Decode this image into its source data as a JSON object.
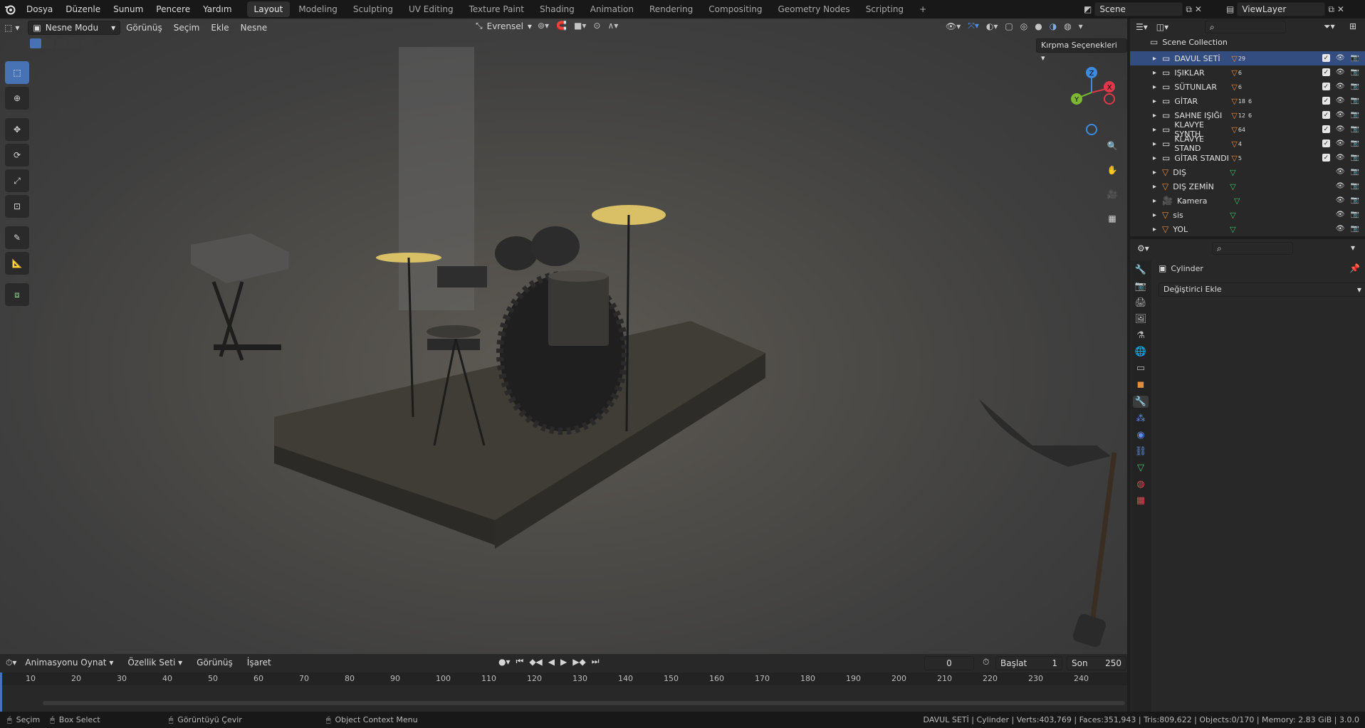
{
  "menubar": {
    "menus": [
      "Dosya",
      "Düzenle",
      "Sunum",
      "Pencere",
      "Yardım"
    ],
    "workspaces": [
      "Layout",
      "Modeling",
      "Sculpting",
      "UV Editing",
      "Texture Paint",
      "Shading",
      "Animation",
      "Rendering",
      "Compositing",
      "Geometry Nodes",
      "Scripting"
    ],
    "active_workspace": "Layout",
    "scene": "Scene",
    "view_layer": "ViewLayer"
  },
  "viewport_header": {
    "mode": "Nesne Modu",
    "menus": [
      "Görünüş",
      "Seçim",
      "Ekle",
      "Nesne"
    ],
    "orientation": "Evrensel",
    "clipping": "Kırpma Seçenekleri"
  },
  "gizmo": {
    "z": "Z",
    "y": "Y",
    "x": "X"
  },
  "outliner": {
    "root": "Scene Collection",
    "rows": [
      {
        "label": "DAVUL SETİ",
        "badge": "29",
        "selected": true,
        "collection": true
      },
      {
        "label": "IŞIKLAR",
        "badge": "6",
        "selected": false,
        "collection": true
      },
      {
        "label": "SÜTUNLAR",
        "badge": "6",
        "selected": false,
        "collection": true
      },
      {
        "label": "GİTAR",
        "badge": "18",
        "badge2": "6",
        "selected": false,
        "collection": true
      },
      {
        "label": "SAHNE IŞIĞI",
        "badge": "12",
        "badge2": "6",
        "selected": false,
        "collection": true
      },
      {
        "label": "KLAVYE SYNTH",
        "badge": "64",
        "selected": false,
        "collection": true
      },
      {
        "label": "KLAVYE STAND",
        "badge": "4",
        "selected": false,
        "collection": true
      },
      {
        "label": "GİTAR STANDI",
        "badge": "5",
        "selected": false,
        "collection": true
      },
      {
        "label": "DIŞ",
        "badge": "",
        "selected": false,
        "collection": false
      },
      {
        "label": "DIŞ ZEMİN",
        "badge": "",
        "selected": false,
        "collection": false
      },
      {
        "label": "Kamera",
        "badge": "",
        "selected": false,
        "collection": false
      },
      {
        "label": "sis",
        "badge": "",
        "selected": false,
        "collection": false
      },
      {
        "label": "YOL",
        "badge": "",
        "selected": false,
        "collection": false
      }
    ]
  },
  "properties": {
    "object_name": "Cylinder",
    "add_modifier": "Değiştirici Ekle"
  },
  "timeline": {
    "playback": "Animasyonu Oynat",
    "keying": "Özellik Seti",
    "view": "Görünüş",
    "marker": "İşaret",
    "current_frame": "0",
    "start_label": "Başlat",
    "start": "1",
    "end_label": "Son",
    "end": "250",
    "ticks": [
      "10",
      "20",
      "30",
      "40",
      "50",
      "60",
      "70",
      "80",
      "90",
      "100",
      "110",
      "120",
      "130",
      "140",
      "150",
      "160",
      "170",
      "180",
      "190",
      "200",
      "210",
      "220",
      "230",
      "240"
    ]
  },
  "statusbar": {
    "select": "Seçim",
    "box_select": "Box Select",
    "rotate_view": "Görüntüyü Çevir",
    "context_menu": "Object Context Menu",
    "stats": "DAVUL SETİ | Cylinder | Verts:403,769 | Faces:351,943 | Tris:809,622 | Objects:0/170 | Memory: 2.83 GiB | 3.0.0"
  },
  "colors": {
    "accent": "#4772b3",
    "selected_row": "#334d80",
    "axis_x": "#e0384b",
    "axis_y": "#7cb832",
    "axis_z": "#3d8be0",
    "cymbal": "#d9c067"
  }
}
